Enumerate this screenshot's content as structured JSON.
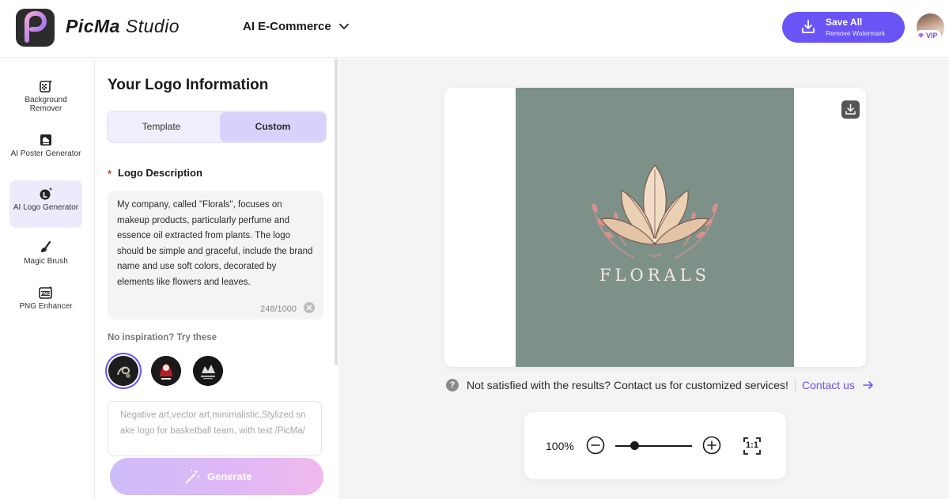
{
  "header": {
    "brand_bold": "PicMa",
    "brand_light": "Studio",
    "category": "AI E-Commerce",
    "save_all": "Save All",
    "remove_watermark": "Remove Watermark",
    "vip": "VIP"
  },
  "sidebar": {
    "items": [
      {
        "label": "Background Remover",
        "icon": "background-remover-icon"
      },
      {
        "label": "AI Poster Generator",
        "icon": "poster-icon"
      },
      {
        "label": "AI Logo Generator",
        "icon": "logo-generator-icon",
        "active": true
      },
      {
        "label": "Magic Brush",
        "icon": "brush-icon"
      },
      {
        "label": "PNG Enhancer",
        "icon": "png-icon"
      }
    ]
  },
  "panel": {
    "title": "Your Logo Information",
    "tabs": [
      "Template",
      "Custom"
    ],
    "active_tab": "Custom",
    "required_mark": "*",
    "description_label": "Logo Description",
    "description": "My company, called \"Florals\", focuses on makeup products, particularly perfume and essence oil extracted from plants. The logo should be simple and graceful, include the brand name and use soft colors, decorated by elements like flowers and leaves.",
    "char_count": "248/1000",
    "inspiration_label": "No inspiration? Try these",
    "prompt_placeholder": "Negative art,vector art,minimalistic,Stylized snake logo for basketball team, with text /PicMa/",
    "generate": "Generate"
  },
  "preview": {
    "logo_text": "FLORALS",
    "background_color": "#7d9189",
    "help_text": "Not satisfied with the results? Contact us for customized services!",
    "contact_link": "Contact us",
    "zoom": "100%",
    "zoom_level": 0.25,
    "fit_label": "1:1"
  },
  "colors": {
    "accent": "#6a54f5",
    "active_bg": "#ecebfb"
  }
}
